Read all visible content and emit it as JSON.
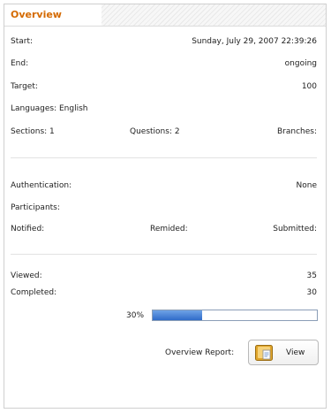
{
  "title": "Overview",
  "info": {
    "start_label": "Start:",
    "start_value": "Sunday, July 29, 2007 22:39:26",
    "end_label": "End:",
    "end_value": "ongoing",
    "target_label": "Target:",
    "target_value": "100",
    "languages_label": "Languages: English",
    "sections_label": "Sections: 1",
    "questions_label": "Questions: 2",
    "branches_label": "Branches:"
  },
  "access": {
    "authentication_label": "Authentication:",
    "authentication_value": "None",
    "participants_label": "Participants:",
    "notified_label": "Notified:",
    "remided_label": "Remided:",
    "submitted_label": "Submitted:"
  },
  "stats": {
    "viewed_label": "Viewed:",
    "viewed_value": "35",
    "completed_label": "Completed:",
    "completed_value": "30",
    "progress_text": "30%",
    "progress_fraction": 0.3
  },
  "report": {
    "label": "Overview Report:",
    "button_label": "View",
    "icon": "document-report-icon"
  },
  "colors": {
    "accent": "#d46a00",
    "progress": "#2f6cc9"
  }
}
